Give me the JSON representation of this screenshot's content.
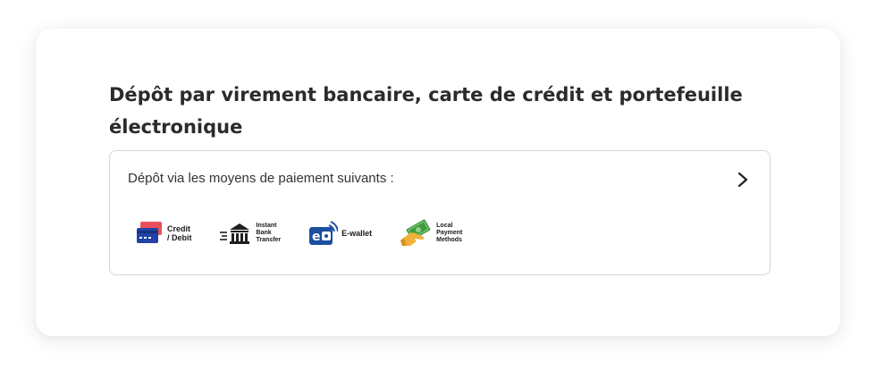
{
  "deposit": {
    "title": "Dépôt par virement bancaire, carte de crédit et portefeuille électronique",
    "subtitle": "Dépôt via les moyens de paiement suivants :",
    "chevron_icon": "chevron-right-icon",
    "methods": [
      {
        "label": "Credit\n/ Debit",
        "icon": "credit-card-icon"
      },
      {
        "label": "Instant\nBank\nTransfer",
        "icon": "bank-icon"
      },
      {
        "label": "E-wallet",
        "icon": "ewallet-icon"
      },
      {
        "label": "Local\nPayment\nMethods",
        "icon": "cash-hand-icon"
      }
    ]
  },
  "colors": {
    "title_text": "#2b2b2b",
    "border": "#d6d6d6",
    "card_blue": "#2143a7",
    "card_red": "#e8505b",
    "bank_dark": "#1f1f1f",
    "ewallet_blue": "#1d4fa0",
    "cash_green": "#3f9a3c",
    "hand_orange": "#f2b23a"
  }
}
